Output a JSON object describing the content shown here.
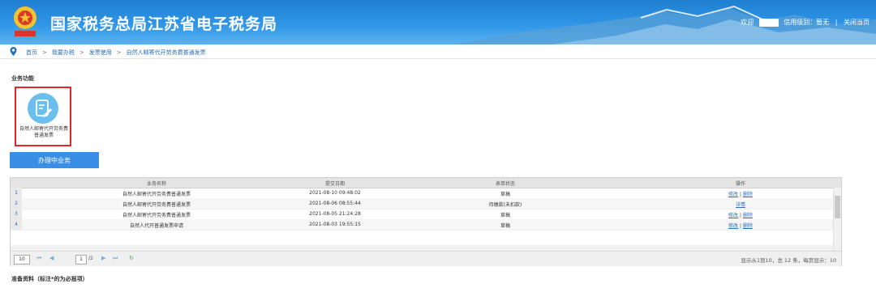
{
  "header": {
    "title": "国家税务总局江苏省电子税务局",
    "welcome": "欢迎",
    "credit": "信用级别：暂无",
    "sep": "|",
    "close": "关闭当页"
  },
  "breadcrumb": {
    "items": [
      "首页",
      "我要办税",
      "发票使用",
      "自然人邮寄代开劳务费普通发票"
    ],
    "arrow": ">"
  },
  "section": {
    "title": "业务功能"
  },
  "function": {
    "label": "自然人邮寄代开劳务费普通发票",
    "icon": "edit-document-icon"
  },
  "tab": {
    "label": "办理中业务"
  },
  "table": {
    "columns": [
      "业务名称",
      "提交日期",
      "表单状态",
      "操作"
    ],
    "rows": [
      {
        "num": "1",
        "name": "自然人邮寄代开劳务费普通发票",
        "date": "2021-08-10 09:48:02",
        "status": "草稿",
        "op1": "修改",
        "opsep": "|",
        "op2": "删除"
      },
      {
        "num": "2",
        "name": "自然人邮寄代开劳务费普通发票",
        "date": "2021-08-06 08:55:44",
        "status": "待缴款(未扣款)",
        "op1": "详情",
        "opsep": "",
        "op2": ""
      },
      {
        "num": "3",
        "name": "自然人邮寄代开劳务费普通发票",
        "date": "2021-08-05 21:24:28",
        "status": "草稿",
        "op1": "修改",
        "opsep": "|",
        "op2": "删除"
      },
      {
        "num": "4",
        "name": "自然人代开普通发票申请",
        "date": "2021-08-03 19:55:15",
        "status": "草稿",
        "op1": "修改",
        "opsep": "|",
        "op2": "删除"
      }
    ]
  },
  "pager": {
    "page_size": "10",
    "page": "1",
    "of_total": "/2",
    "info": "显示从1到10，总 12 条，每页显示：10"
  },
  "footer": {
    "prep_title": "准备资料（标注*的为必报项）"
  },
  "colors": {
    "header": "#2f95e6",
    "accent": "#3a8ee6",
    "highlight": "#e0262a"
  }
}
